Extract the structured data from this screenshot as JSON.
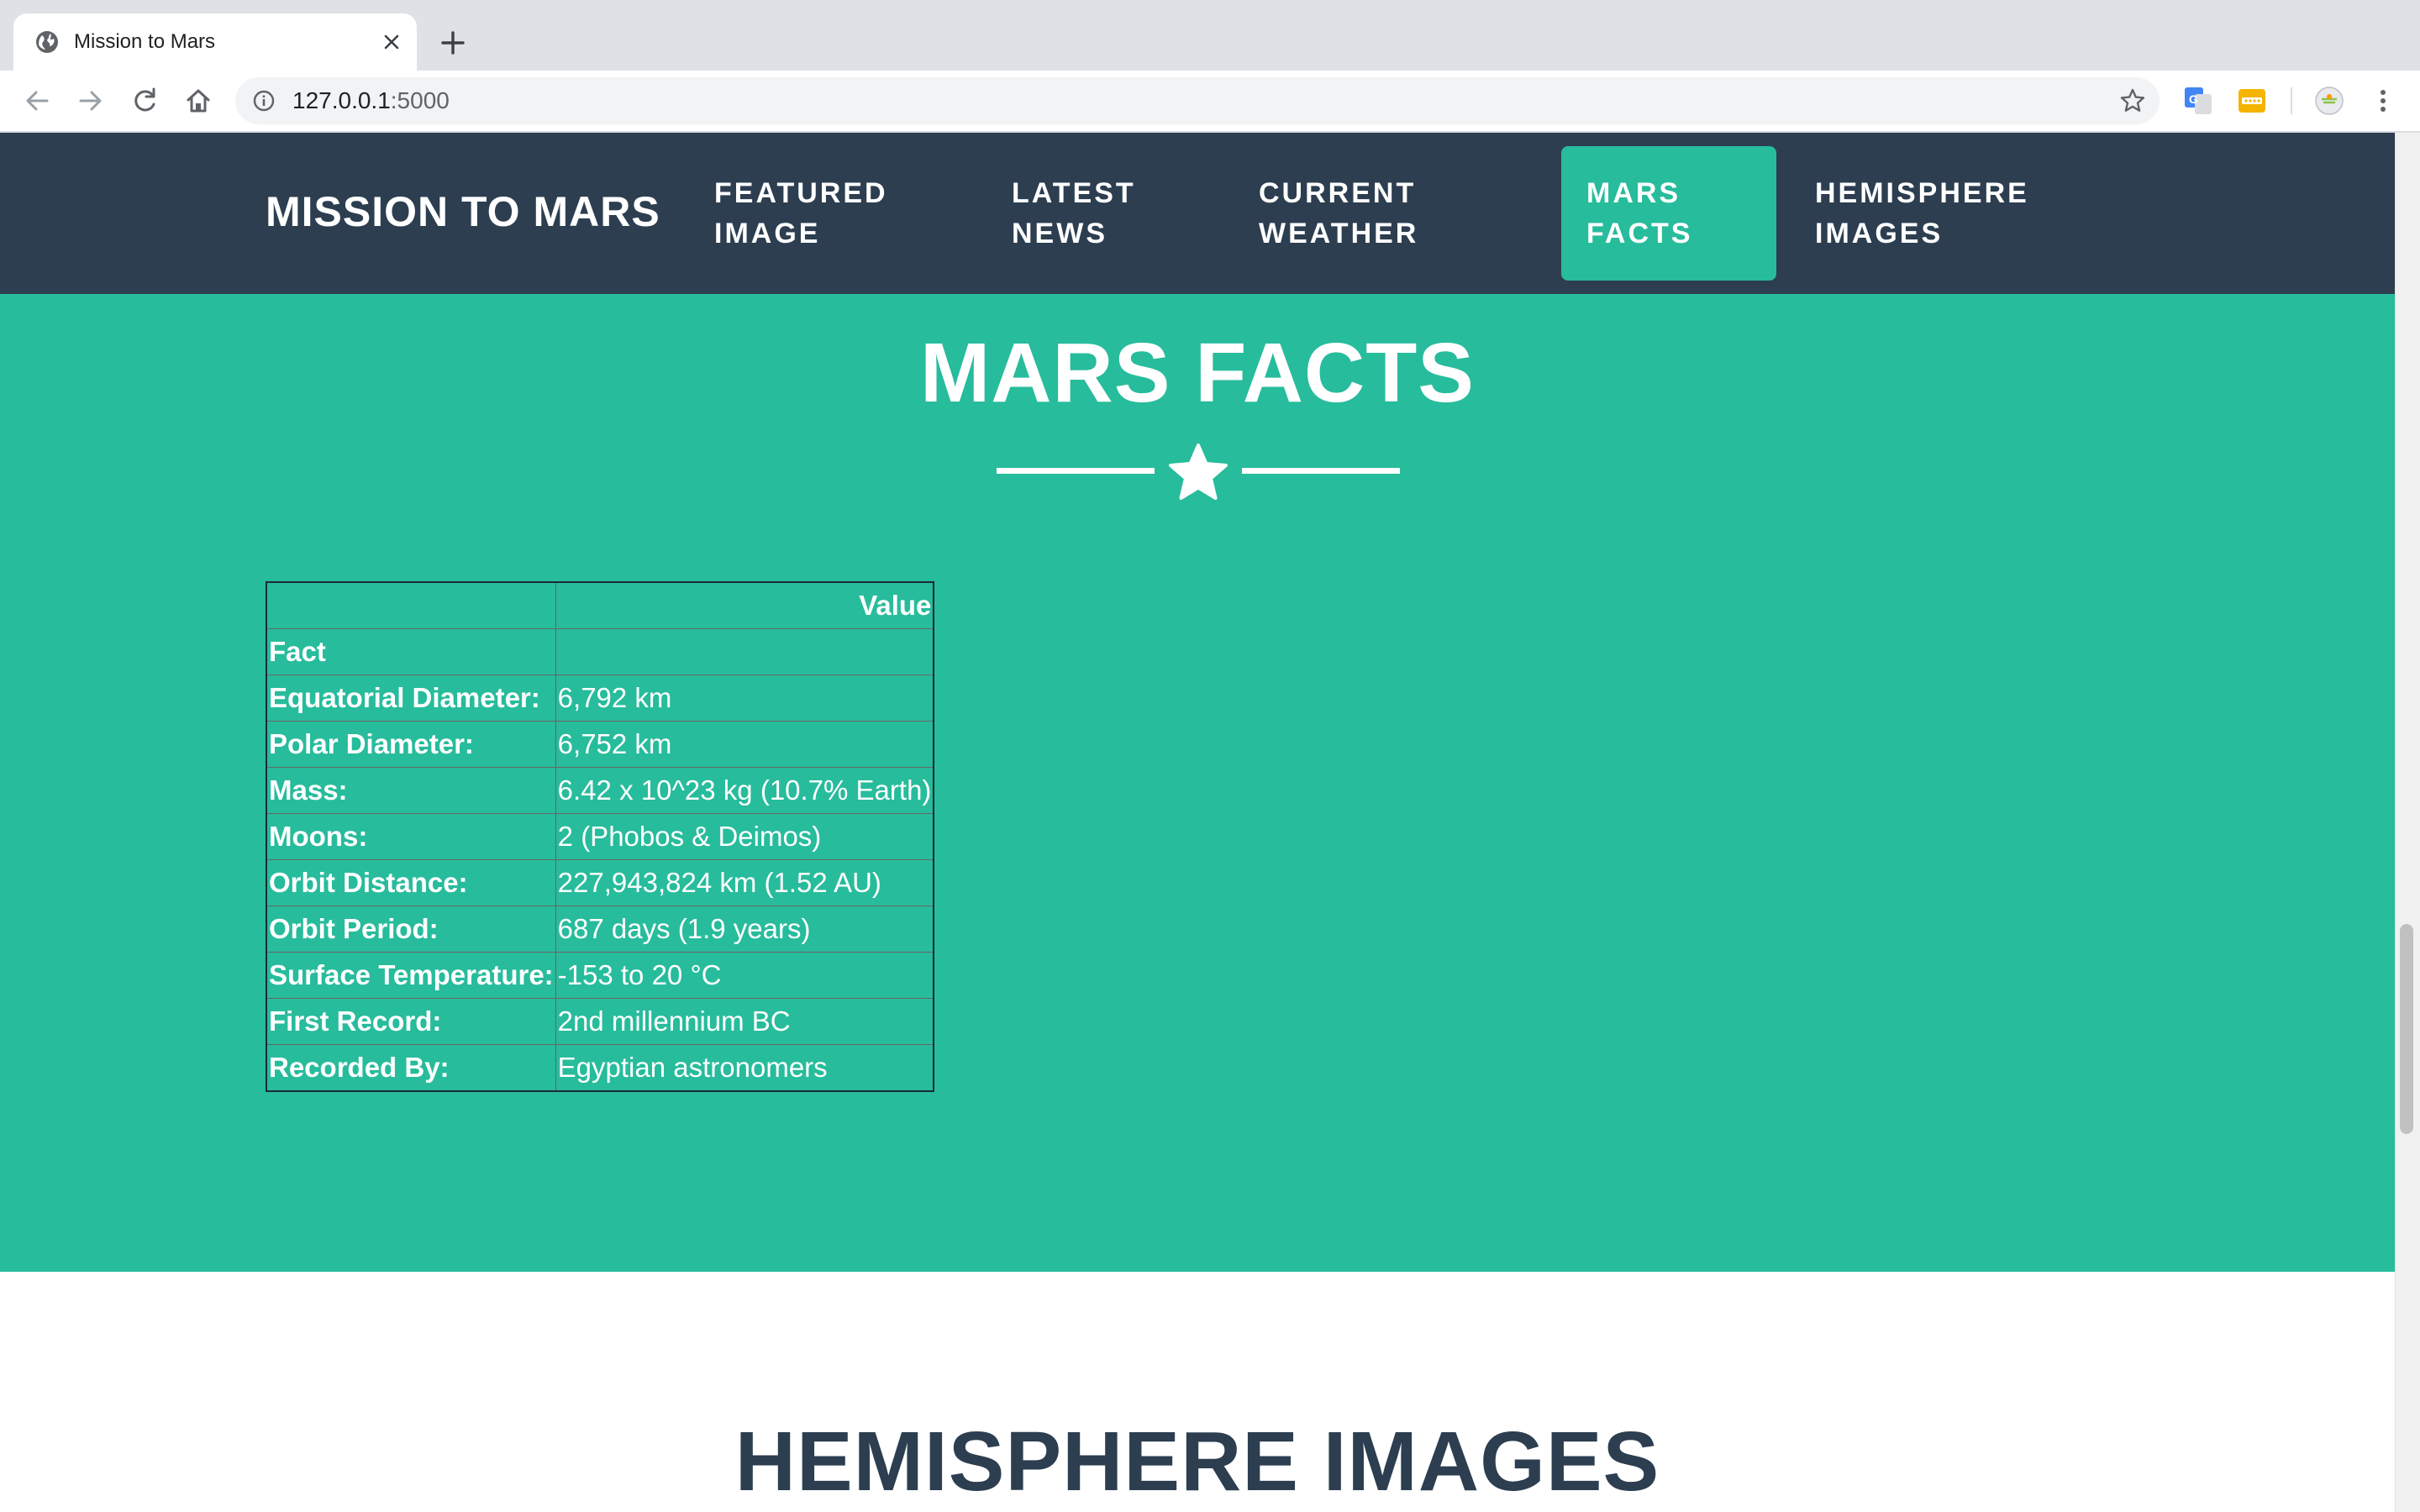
{
  "browser": {
    "tab_title": "Mission to Mars",
    "url_host": "127.0.0.1",
    "url_port": ":5000"
  },
  "navbar": {
    "brand": "MISSION TO MARS",
    "items": [
      {
        "line1": "FEATURED",
        "line2": "IMAGE"
      },
      {
        "line1": "LATEST",
        "line2": "NEWS"
      },
      {
        "line1": "CURRENT",
        "line2": "WEATHER"
      },
      {
        "line1": "MARS",
        "line2": "FACTS"
      },
      {
        "line1": "HEMISPHERE",
        "line2": "IMAGES"
      }
    ],
    "active_index": 3
  },
  "facts": {
    "title": "MARS FACTS",
    "header_value": "Value",
    "header_index": "Fact",
    "rows": [
      {
        "fact": "Equatorial Diameter:",
        "value": "6,792 km"
      },
      {
        "fact": "Polar Diameter:",
        "value": "6,752 km"
      },
      {
        "fact": "Mass:",
        "value": "6.42 x 10^23 kg (10.7% Earth)"
      },
      {
        "fact": "Moons:",
        "value": "2 (Phobos & Deimos)"
      },
      {
        "fact": "Orbit Distance:",
        "value": "227,943,824 km (1.52 AU)"
      },
      {
        "fact": "Orbit Period:",
        "value": "687 days (1.9 years)"
      },
      {
        "fact": "Surface Temperature:",
        "value": "-153 to 20 °C"
      },
      {
        "fact": "First Record:",
        "value": "2nd millennium BC"
      },
      {
        "fact": "Recorded By:",
        "value": "Egyptian astronomers"
      }
    ]
  },
  "hemispheres": {
    "title": "HEMISPHERE IMAGES"
  },
  "colors": {
    "navbar_bg": "#2c3e50",
    "accent_teal": "#27bc9c",
    "text_dark": "#2c3e50"
  },
  "icons": [
    "globe-icon",
    "close-icon",
    "plus-icon",
    "back-arrow-icon",
    "forward-arrow-icon",
    "reload-icon",
    "home-icon",
    "info-icon",
    "bookmark-star-icon",
    "translate-extension-icon",
    "password-extension-icon",
    "profile-avatar-icon",
    "menu-kebab-icon",
    "star-icon"
  ]
}
